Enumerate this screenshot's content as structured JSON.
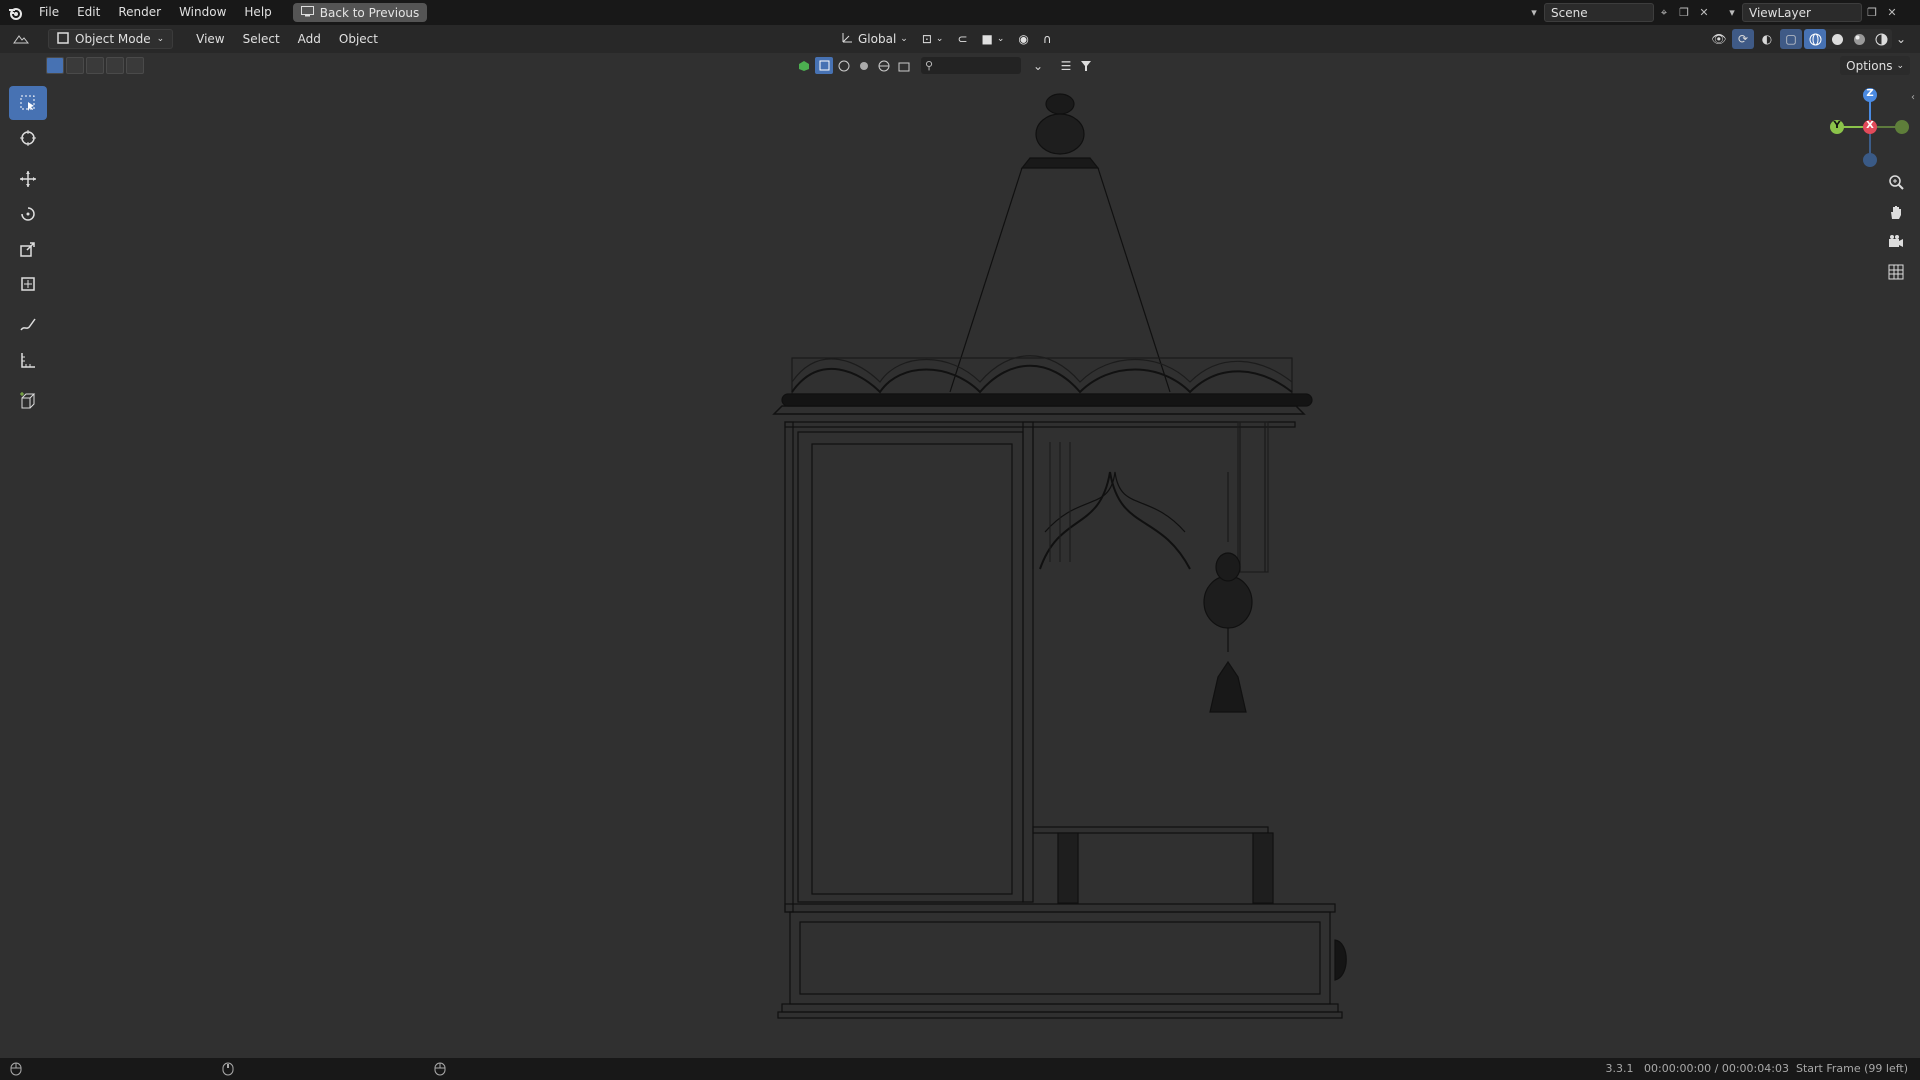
{
  "menubar": {
    "items": [
      "File",
      "Edit",
      "Render",
      "Window",
      "Help"
    ],
    "back_button": "Back to Previous",
    "scene": "Scene",
    "view_layer": "ViewLayer"
  },
  "viewport_header": {
    "mode": "Object Mode",
    "menus": [
      "View",
      "Select",
      "Add",
      "Object"
    ],
    "transform_orientation": "Global"
  },
  "options_label": "Options",
  "gizmo": {
    "z": "Z",
    "y": "Y",
    "x": "X"
  },
  "status": {
    "version": "3.3.1",
    "time": "00:00:00:00 / 00:00:04:03",
    "frame_info": "Start Frame (99 left)"
  },
  "colors": {
    "accent": "#4772b3",
    "axis_x": "#e24a5a",
    "axis_y": "#8bc34a",
    "axis_z": "#4a8ae2",
    "background": "#303030"
  }
}
